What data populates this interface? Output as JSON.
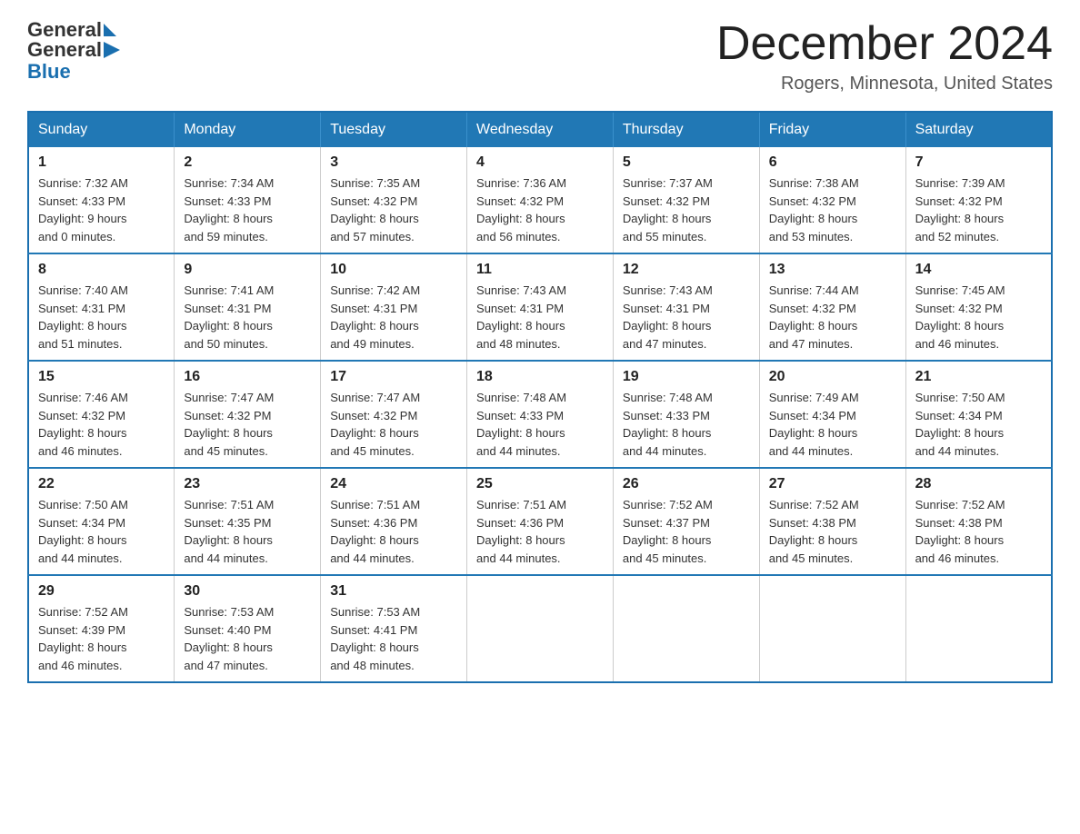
{
  "logo": {
    "text_general": "General",
    "text_blue": "Blue",
    "arrow": "▶"
  },
  "title": "December 2024",
  "location": "Rogers, Minnesota, United States",
  "days_of_week": [
    "Sunday",
    "Monday",
    "Tuesday",
    "Wednesday",
    "Thursday",
    "Friday",
    "Saturday"
  ],
  "weeks": [
    [
      {
        "day": "1",
        "sunrise": "7:32 AM",
        "sunset": "4:33 PM",
        "daylight": "9 hours and 0 minutes."
      },
      {
        "day": "2",
        "sunrise": "7:34 AM",
        "sunset": "4:33 PM",
        "daylight": "8 hours and 59 minutes."
      },
      {
        "day": "3",
        "sunrise": "7:35 AM",
        "sunset": "4:32 PM",
        "daylight": "8 hours and 57 minutes."
      },
      {
        "day": "4",
        "sunrise": "7:36 AM",
        "sunset": "4:32 PM",
        "daylight": "8 hours and 56 minutes."
      },
      {
        "day": "5",
        "sunrise": "7:37 AM",
        "sunset": "4:32 PM",
        "daylight": "8 hours and 55 minutes."
      },
      {
        "day": "6",
        "sunrise": "7:38 AM",
        "sunset": "4:32 PM",
        "daylight": "8 hours and 53 minutes."
      },
      {
        "day": "7",
        "sunrise": "7:39 AM",
        "sunset": "4:32 PM",
        "daylight": "8 hours and 52 minutes."
      }
    ],
    [
      {
        "day": "8",
        "sunrise": "7:40 AM",
        "sunset": "4:31 PM",
        "daylight": "8 hours and 51 minutes."
      },
      {
        "day": "9",
        "sunrise": "7:41 AM",
        "sunset": "4:31 PM",
        "daylight": "8 hours and 50 minutes."
      },
      {
        "day": "10",
        "sunrise": "7:42 AM",
        "sunset": "4:31 PM",
        "daylight": "8 hours and 49 minutes."
      },
      {
        "day": "11",
        "sunrise": "7:43 AM",
        "sunset": "4:31 PM",
        "daylight": "8 hours and 48 minutes."
      },
      {
        "day": "12",
        "sunrise": "7:43 AM",
        "sunset": "4:31 PM",
        "daylight": "8 hours and 47 minutes."
      },
      {
        "day": "13",
        "sunrise": "7:44 AM",
        "sunset": "4:32 PM",
        "daylight": "8 hours and 47 minutes."
      },
      {
        "day": "14",
        "sunrise": "7:45 AM",
        "sunset": "4:32 PM",
        "daylight": "8 hours and 46 minutes."
      }
    ],
    [
      {
        "day": "15",
        "sunrise": "7:46 AM",
        "sunset": "4:32 PM",
        "daylight": "8 hours and 46 minutes."
      },
      {
        "day": "16",
        "sunrise": "7:47 AM",
        "sunset": "4:32 PM",
        "daylight": "8 hours and 45 minutes."
      },
      {
        "day": "17",
        "sunrise": "7:47 AM",
        "sunset": "4:32 PM",
        "daylight": "8 hours and 45 minutes."
      },
      {
        "day": "18",
        "sunrise": "7:48 AM",
        "sunset": "4:33 PM",
        "daylight": "8 hours and 44 minutes."
      },
      {
        "day": "19",
        "sunrise": "7:48 AM",
        "sunset": "4:33 PM",
        "daylight": "8 hours and 44 minutes."
      },
      {
        "day": "20",
        "sunrise": "7:49 AM",
        "sunset": "4:34 PM",
        "daylight": "8 hours and 44 minutes."
      },
      {
        "day": "21",
        "sunrise": "7:50 AM",
        "sunset": "4:34 PM",
        "daylight": "8 hours and 44 minutes."
      }
    ],
    [
      {
        "day": "22",
        "sunrise": "7:50 AM",
        "sunset": "4:34 PM",
        "daylight": "8 hours and 44 minutes."
      },
      {
        "day": "23",
        "sunrise": "7:51 AM",
        "sunset": "4:35 PM",
        "daylight": "8 hours and 44 minutes."
      },
      {
        "day": "24",
        "sunrise": "7:51 AM",
        "sunset": "4:36 PM",
        "daylight": "8 hours and 44 minutes."
      },
      {
        "day": "25",
        "sunrise": "7:51 AM",
        "sunset": "4:36 PM",
        "daylight": "8 hours and 44 minutes."
      },
      {
        "day": "26",
        "sunrise": "7:52 AM",
        "sunset": "4:37 PM",
        "daylight": "8 hours and 45 minutes."
      },
      {
        "day": "27",
        "sunrise": "7:52 AM",
        "sunset": "4:38 PM",
        "daylight": "8 hours and 45 minutes."
      },
      {
        "day": "28",
        "sunrise": "7:52 AM",
        "sunset": "4:38 PM",
        "daylight": "8 hours and 46 minutes."
      }
    ],
    [
      {
        "day": "29",
        "sunrise": "7:52 AM",
        "sunset": "4:39 PM",
        "daylight": "8 hours and 46 minutes."
      },
      {
        "day": "30",
        "sunrise": "7:53 AM",
        "sunset": "4:40 PM",
        "daylight": "8 hours and 47 minutes."
      },
      {
        "day": "31",
        "sunrise": "7:53 AM",
        "sunset": "4:41 PM",
        "daylight": "8 hours and 48 minutes."
      },
      null,
      null,
      null,
      null
    ]
  ]
}
